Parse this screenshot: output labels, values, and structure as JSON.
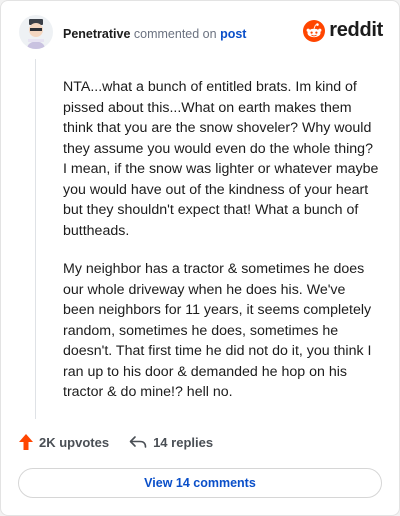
{
  "header": {
    "username": "Penetrative",
    "action_text": "commented on",
    "post_link": "post"
  },
  "brand": {
    "wordmark": "reddit",
    "icon": "reddit-snoo-icon",
    "accent_color": "#ff4500"
  },
  "comment": {
    "paragraphs": [
      "NTA...what a bunch of entitled brats. Im kind of pissed about this...What on earth makes them think that you are the snow shoveler? Why would they assume you would even do the whole thing? I mean, if the snow was lighter or whatever maybe you would have out of the kindness of your heart but they shouldn't expect that! What a bunch of buttheads.",
      "My neighbor has a tractor & sometimes he does our whole driveway when he does his. We've been neighbors for 11 years, it seems completely random, sometimes he does, sometimes he doesn't. That first time he did not do it, you think I ran up to his door & demanded he hop on his tractor & do mine!? hell no."
    ]
  },
  "actions": {
    "upvotes_label": "2K upvotes",
    "upvote_icon": "upvote-arrow-icon",
    "upvote_color": "#ff4500",
    "replies_label": "14 replies",
    "reply_icon": "reply-arrow-icon"
  },
  "footer": {
    "view_comments_label": "View 14 comments",
    "link_color": "#0a4fc9"
  }
}
